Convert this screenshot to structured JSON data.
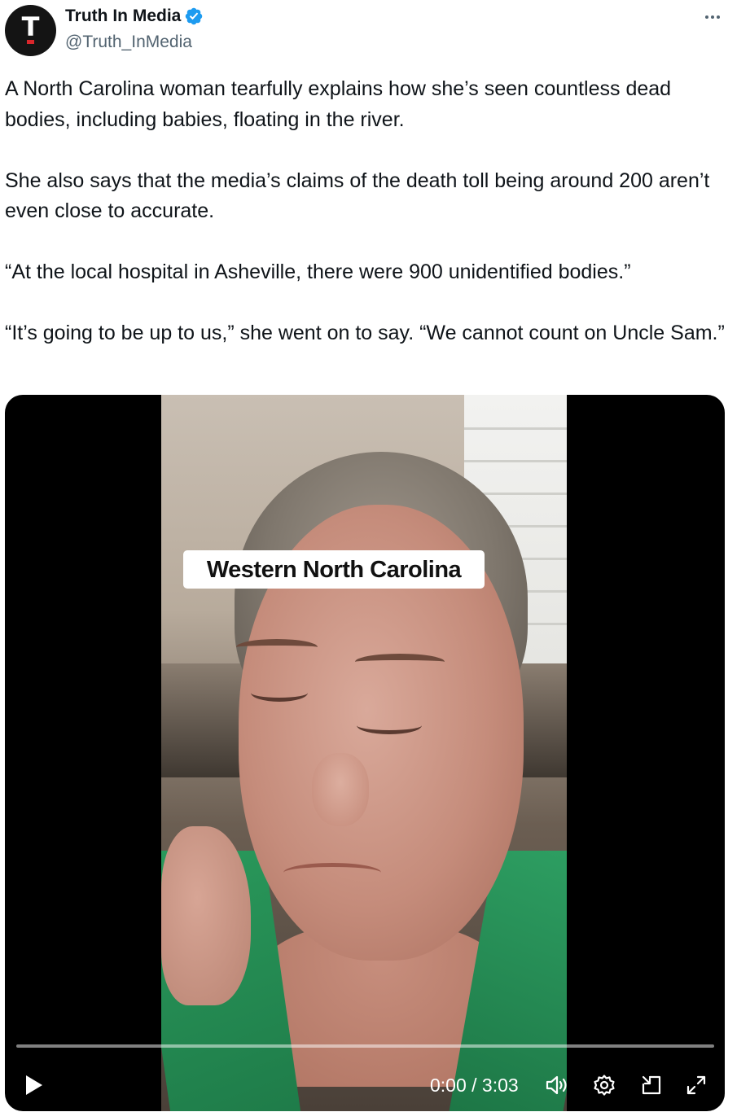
{
  "author": {
    "display_name": "Truth In Media",
    "handle": "@Truth_InMedia",
    "avatar_letter": "T",
    "verified": true,
    "verified_color": "#1d9bf0"
  },
  "tweet": {
    "paragraphs": [
      "A North Carolina woman tearfully explains how she’s seen countless dead bodies, including babies, floating in the river.",
      "She also says that the media’s claims of the death toll being around 200 aren’t even close to accurate.",
      "“At the local hospital in Asheville, there were 900 unidentified bodies.”",
      "“It’s going to be up to us,” she went on to say. “We cannot count on Uncle Sam.”"
    ]
  },
  "video": {
    "caption_overlay": "Western North Carolina",
    "time_display": "0:00 / 3:03",
    "progress": 0,
    "icons": {
      "play": "play-icon",
      "volume": "volume-icon",
      "settings": "gear-icon",
      "dock": "dock-icon",
      "fullscreen": "fullscreen-icon"
    }
  },
  "menu": {
    "icon": "more-icon"
  }
}
